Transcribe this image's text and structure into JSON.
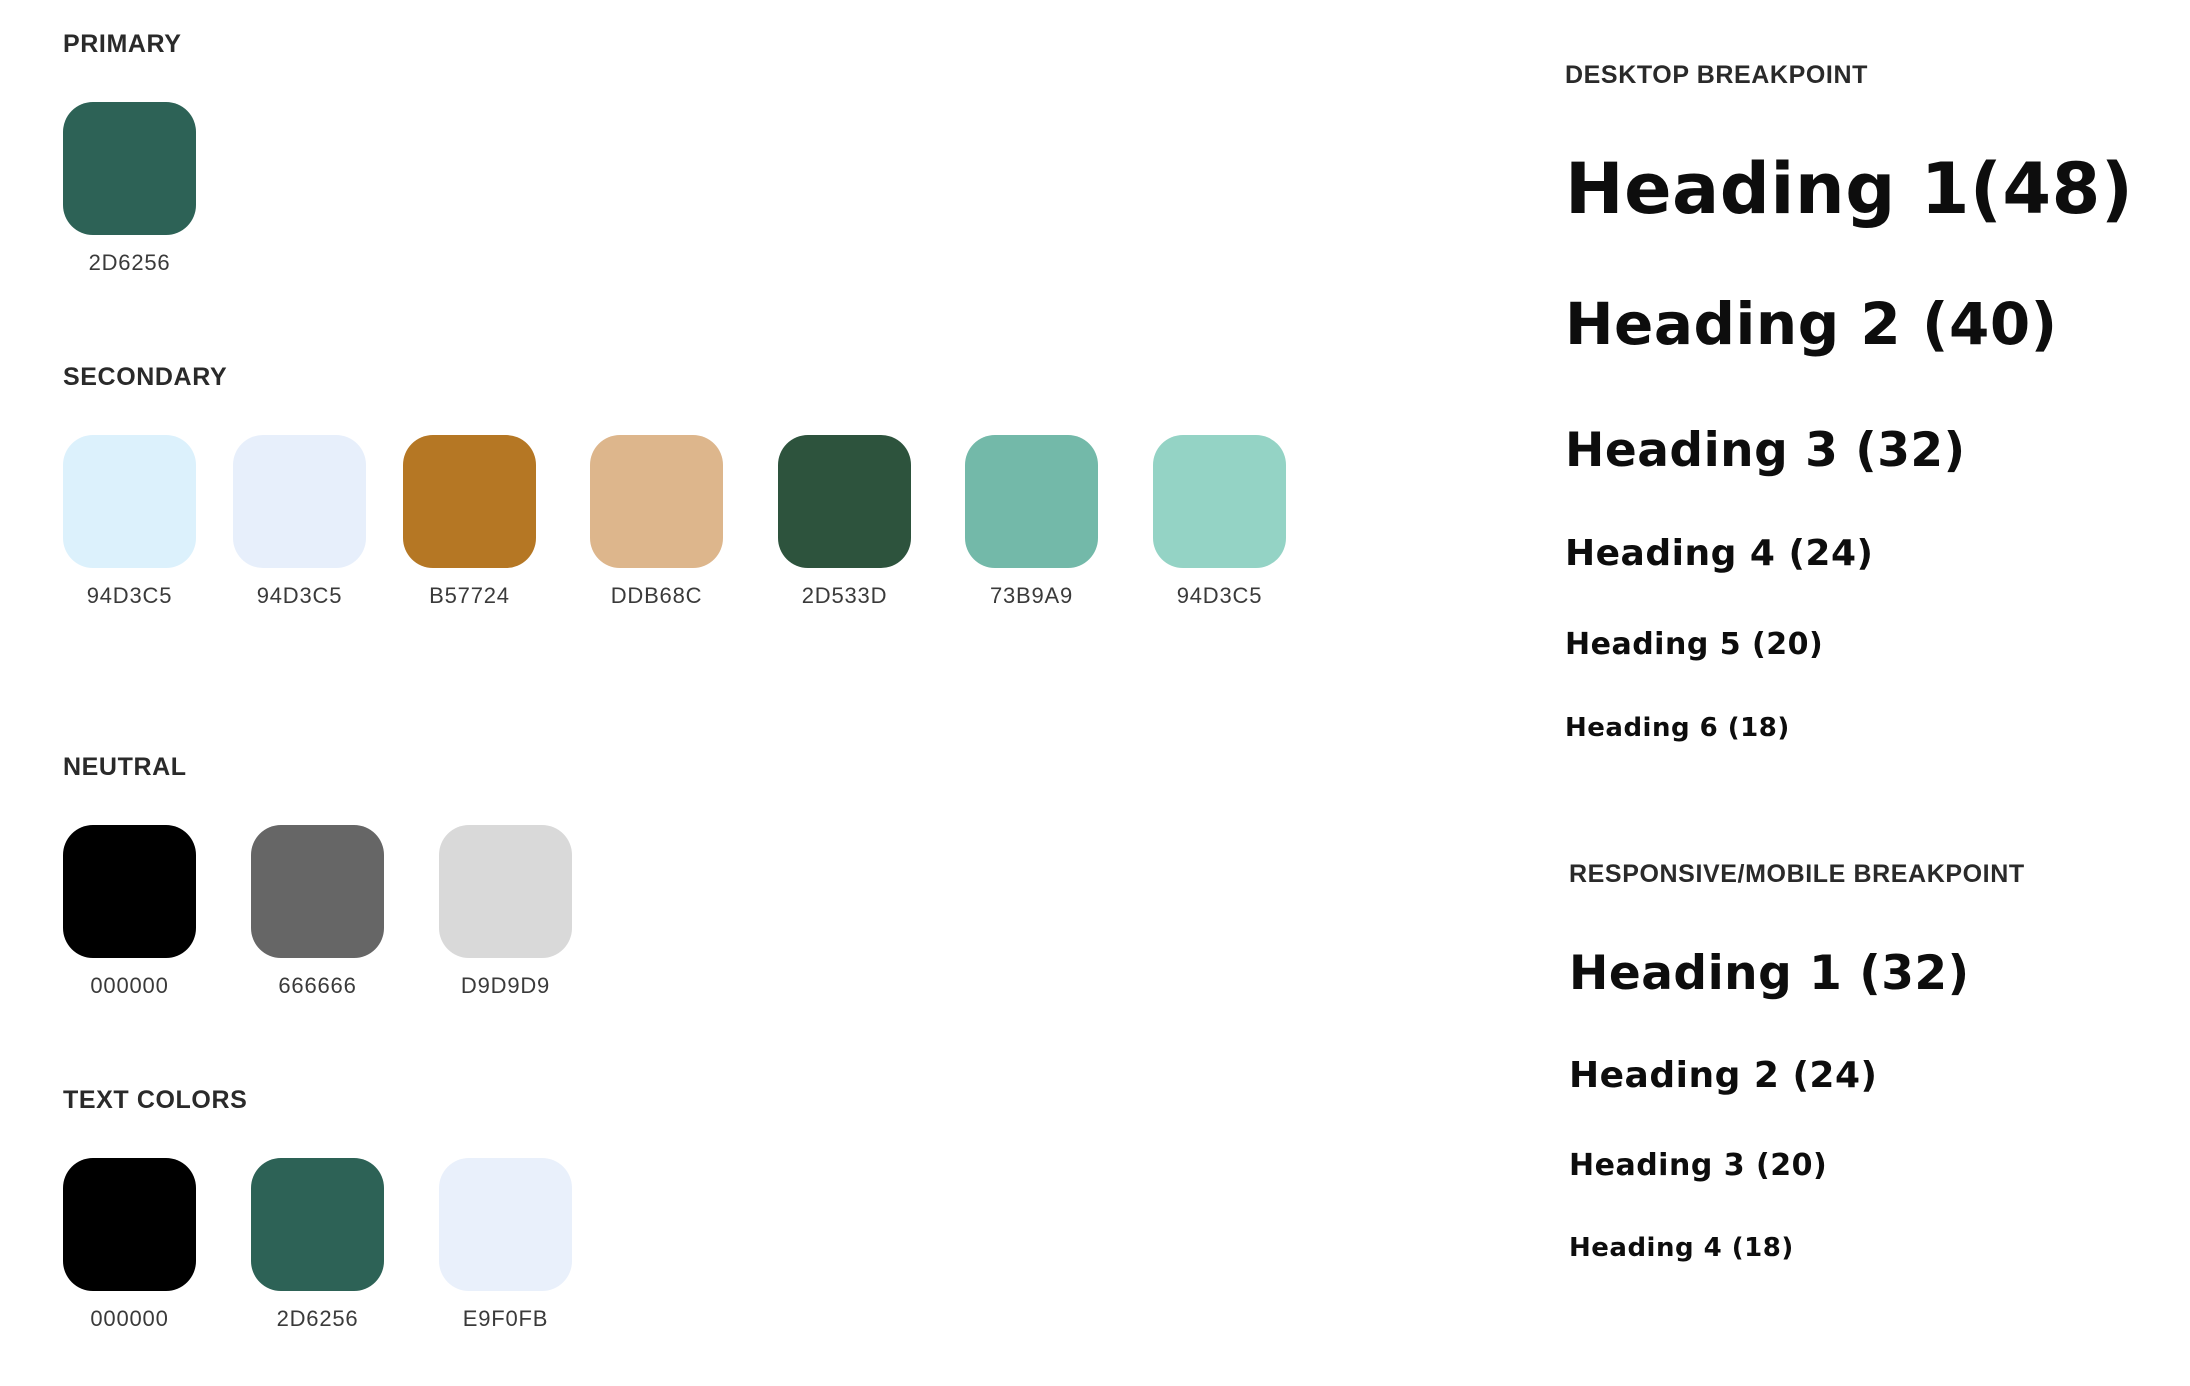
{
  "palette": {
    "primary": {
      "title": "PRIMARY",
      "swatches": [
        {
          "code": "2D6256",
          "color": "#2D6256"
        }
      ]
    },
    "secondary": {
      "title": "SECONDARY",
      "swatches": [
        {
          "code": "94D3C5",
          "color": "#DCF1FC"
        },
        {
          "code": "94D3C5",
          "color": "#E7EFFB"
        },
        {
          "code": "B57724",
          "color": "#B57724"
        },
        {
          "code": "DDB68C",
          "color": "#DDB68C"
        },
        {
          "code": "2D533D",
          "color": "#2D533D"
        },
        {
          "code": "73B9A9",
          "color": "#73B9A9"
        },
        {
          "code": "94D3C5",
          "color": "#94D3C5"
        }
      ]
    },
    "neutral": {
      "title": "NEUTRAL",
      "swatches": [
        {
          "code": "000000",
          "color": "#000000"
        },
        {
          "code": "666666",
          "color": "#666666"
        },
        {
          "code": "D9D9D9",
          "color": "#D9D9D9"
        }
      ]
    },
    "text_colors": {
      "title": "TEXT COLORS",
      "swatches": [
        {
          "code": "000000",
          "color": "#000000"
        },
        {
          "code": "2D6256",
          "color": "#2D6256"
        },
        {
          "code": "E9F0FB",
          "color": "#E9F0FB"
        }
      ]
    }
  },
  "typography": {
    "desktop": {
      "title": "DESKTOP BREAKPOINT",
      "headings": [
        "Heading 1(48)",
        "Heading 2 (40)",
        "Heading 3 (32)",
        "Heading 4 (24)",
        "Heading 5 (20)",
        "Heading 6 (18)"
      ]
    },
    "mobile": {
      "title": "RESPONSIVE/MOBILE BREAKPOINT",
      "headings": [
        "Heading 1 (32)",
        "Heading 2 (24)",
        "Heading 3 (20)",
        "Heading 4 (18)"
      ]
    }
  }
}
